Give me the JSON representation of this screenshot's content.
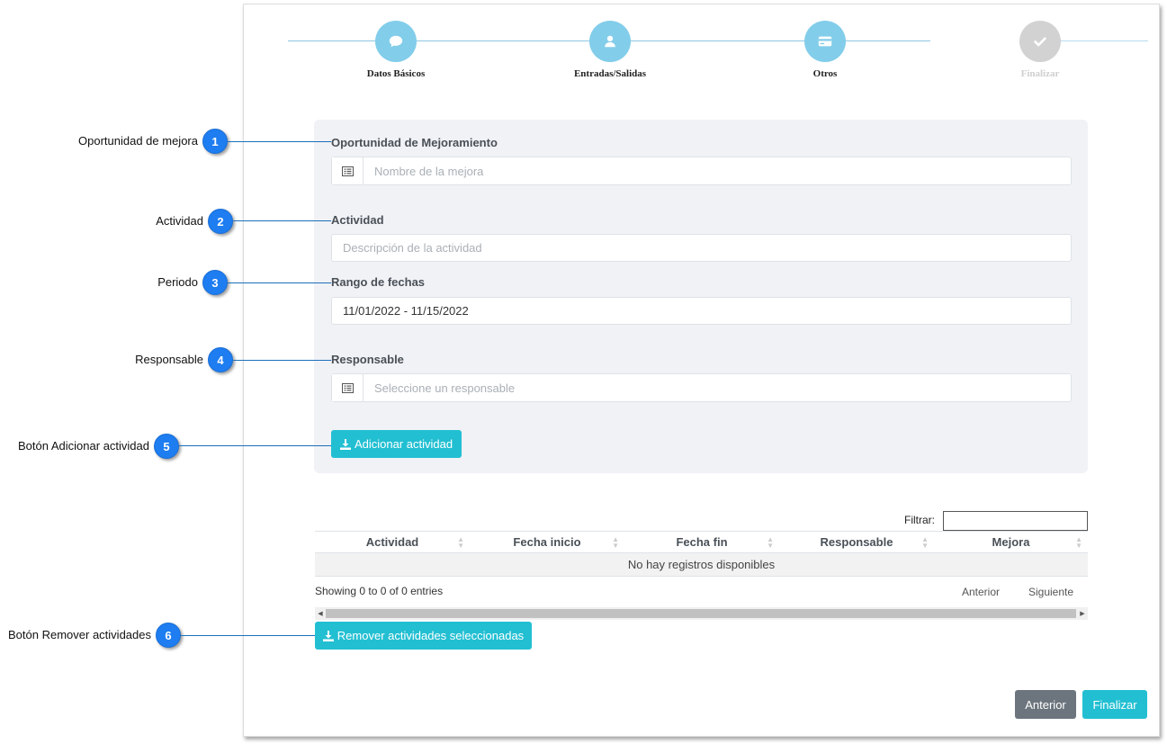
{
  "wizard": {
    "steps": [
      {
        "label": "Datos Básicos",
        "icon": "chat-bubble-icon"
      },
      {
        "label": "Entradas/Salidas",
        "icon": "user-icon"
      },
      {
        "label": "Otros",
        "icon": "credit-card-icon"
      },
      {
        "label": "Finalizar",
        "icon": "checkmark-icon"
      }
    ]
  },
  "form": {
    "oportunidad": {
      "label": "Oportunidad de Mejoramiento",
      "placeholder": "Nombre de la mejora"
    },
    "actividad": {
      "label": "Actividad",
      "placeholder": "Descripción de la actividad"
    },
    "rango": {
      "label": "Rango de fechas",
      "value": "11/01/2022 - 11/15/2022"
    },
    "responsable": {
      "label": "Responsable",
      "placeholder": "Seleccione un responsable"
    },
    "add_button": "Adicionar actividad"
  },
  "table": {
    "filter_label": "Filtrar:",
    "columns": [
      "Actividad",
      "Fecha inicio",
      "Fecha fin",
      "Responsable",
      "Mejora"
    ],
    "empty_text": "No hay registros disponibles",
    "info": "Showing 0 to 0 of 0 entries",
    "prev": "Anterior",
    "next": "Siguiente"
  },
  "remove_button": "Remover actividades seleccionadas",
  "footer": {
    "prev": "Anterior",
    "finish": "Finalizar"
  },
  "callouts": [
    {
      "num": "1",
      "text": "Oportunidad de mejora"
    },
    {
      "num": "2",
      "text": "Actividad"
    },
    {
      "num": "3",
      "text": "Periodo"
    },
    {
      "num": "4",
      "text": "Responsable"
    },
    {
      "num": "5",
      "text": "Botón Adicionar actividad"
    },
    {
      "num": "6",
      "text": "Botón Remover actividades"
    }
  ],
  "colors": {
    "accent": "#22bfd2",
    "wizard_active": "#82cdea",
    "wizard_done": "#d2d2d2",
    "callout": "#1e7df0",
    "button_gray": "#6c757d"
  }
}
